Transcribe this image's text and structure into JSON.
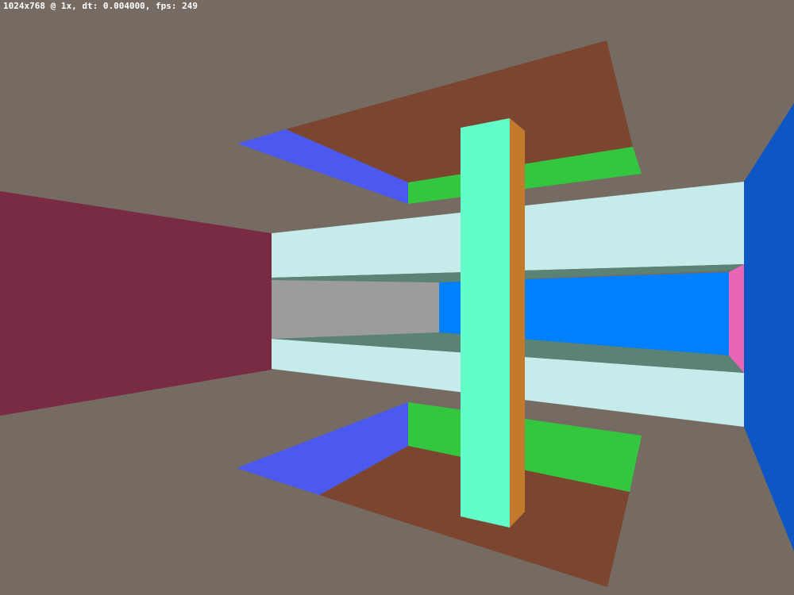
{
  "overlay": {
    "stats_text": "1024x768 @ 1x, dt: 0.004000, fps: 249"
  },
  "colors": {
    "background": "#756b62",
    "left_wall": "#7a2b44",
    "light_panel": "#c5ecea",
    "gray_panel": "#9c9c9c",
    "blue_panel": "#0080ff",
    "dark_teal": "#5a8275",
    "pink_panel": "#e865b7",
    "right_wall": "#0c57c4",
    "brown_slab": "#7b4530",
    "blue_slab": "#4b59ef",
    "green_slab": "#35c63f",
    "mint_pillar": "#63fdc9",
    "orange_pillar": "#c47a2c"
  }
}
